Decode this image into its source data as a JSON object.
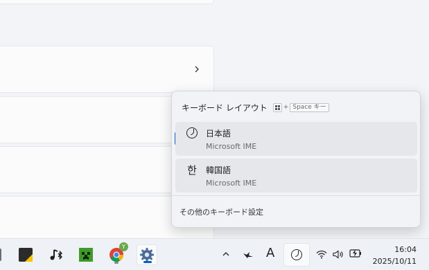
{
  "flyout": {
    "title": "キーボード レイアウト",
    "shortcut_plus": "+",
    "shortcut_key": "Space キー",
    "items": [
      {
        "icon": "ime-japanese-icon",
        "name": "日本語",
        "sub": "Microsoft IME",
        "selected": true
      },
      {
        "icon_glyph": "한",
        "icon": "ime-korean-icon",
        "name": "韓国語",
        "sub": "Microsoft IME",
        "selected": false
      }
    ],
    "footer": "その他のキーボード設定"
  },
  "taskbar": {
    "tray_ime_glyph": "A",
    "time": "16:04",
    "date": "2025/10/11",
    "chrome_badge": "Y"
  },
  "colors": {
    "accent": "#0a5fc4",
    "flyout_bg": "#f1f3f6",
    "item_bg": "#e5e7ea"
  }
}
